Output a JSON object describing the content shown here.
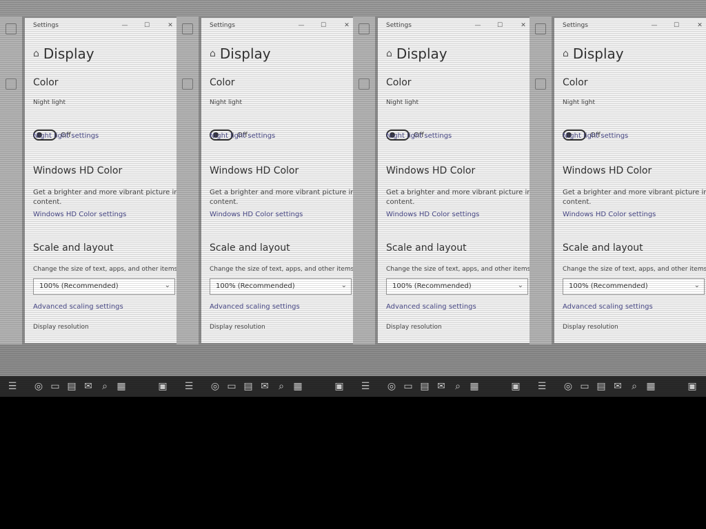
{
  "app_title": "Settings",
  "page_title": "Display",
  "sections": {
    "color": "Color",
    "hdr": "Windows HD Color",
    "scale": "Scale and layout"
  },
  "night_light": {
    "label": "Night light",
    "state": "Off",
    "settings_link": "Night light settings"
  },
  "hdr": {
    "description": "Get a brighter and more vibrant picture in HDR and WCG",
    "description_line2": "content.",
    "settings_link": "Windows HD Color settings"
  },
  "scale": {
    "label": "Change the size of text, apps, and other items",
    "selected": "100% (Recommended)",
    "advanced_link": "Advanced scaling settings"
  },
  "resolution": {
    "label": "Display resolution"
  },
  "window_controls": {
    "minimize": "—",
    "maximize": "☐",
    "close": "✕"
  },
  "taskbar": {
    "start": "☰",
    "apps": [
      "◎",
      "▭",
      "▤",
      "✉",
      "⌕",
      "▦",
      "⚙"
    ],
    "tray": "▣"
  }
}
